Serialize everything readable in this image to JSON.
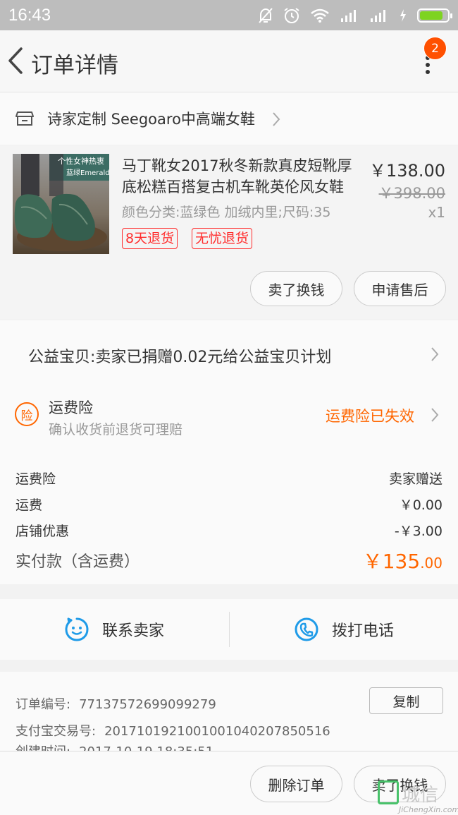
{
  "status_bar": {
    "time": "16:43",
    "battery_level_fraction": 0.85
  },
  "header": {
    "title": "订单详情",
    "notification_count": "2"
  },
  "shop": {
    "name": "诗家定制 Seegoaro中高端女鞋"
  },
  "item": {
    "thumb_text_line1": "个性女神热衷",
    "thumb_text_line2": "蓝绿Emerald",
    "title": "马丁靴女2017秋冬新款真皮短靴厚底松糕百搭复古机车靴英伦风女鞋",
    "spec": "颜色分类:蓝绿色 加绒内里;尺码:35",
    "price": "￥138.00",
    "original_price": "￥398.00",
    "quantity": "x1",
    "tags": [
      "8天退货",
      "无忧退货"
    ],
    "actions": [
      "卖了换钱",
      "申请售后"
    ]
  },
  "charity": {
    "text": "公益宝贝:卖家已捐赠0.02元给公益宝贝计划"
  },
  "insurance": {
    "icon_char": "险",
    "title": "运费险",
    "subtitle": "确认收货前退货可理赔",
    "status": "运费险已失效"
  },
  "fees": {
    "rows": [
      {
        "label": "运费险",
        "value": "卖家赠送"
      },
      {
        "label": "运费",
        "value": "￥0.00"
      },
      {
        "label": "店铺优惠",
        "value": "-￥3.00"
      }
    ],
    "total_label": "实付款（含运费）",
    "total_main": "￥135",
    "total_decimal": ".00"
  },
  "contact": {
    "seller_label": "联系卖家",
    "phone_label": "拨打电话"
  },
  "order_info": {
    "order_no_label": "订单编号:",
    "order_no": "7713757269909927​9",
    "copy_label": "复制",
    "alipay_label": "支付宝交易号:",
    "alipay_no": "2017101921001001040207850516",
    "created_label": "创建时间:",
    "created_value": "2017-10-19 18:35:51"
  },
  "bottom_actions": {
    "delete_label": "删除订单",
    "sell_label": "卖了换钱"
  },
  "watermark": {
    "cn": "城信",
    "en": "JiChengXin.com"
  },
  "colors": {
    "accent": "#ff6600",
    "tag_red": "#ff2d2d",
    "badge": "#ff5000",
    "icon_blue": "#1f9be8"
  }
}
